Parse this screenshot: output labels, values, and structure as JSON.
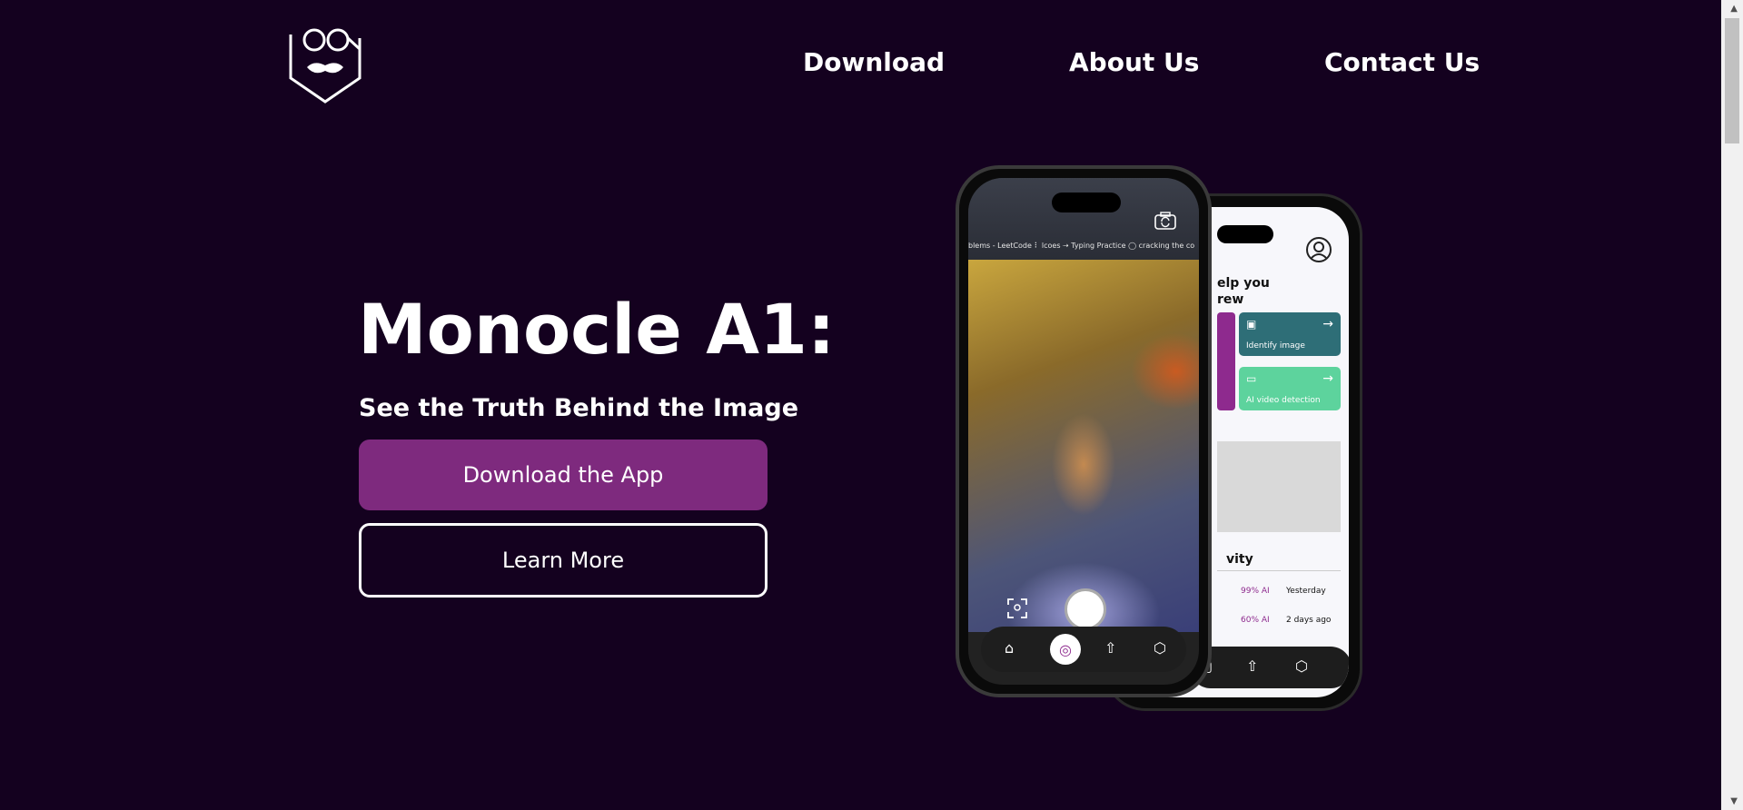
{
  "header": {
    "logo_alt": "Monocle logo",
    "nav": [
      {
        "label": "Download"
      },
      {
        "label": "About Us"
      },
      {
        "label": "Contact Us"
      }
    ]
  },
  "hero": {
    "title": "Monocle A1:",
    "subtitle": "See the Truth Behind the Image",
    "primary_button": "Download the App",
    "secondary_button": "Learn More"
  },
  "phone_back": {
    "heading": "elp you\nrew",
    "cards": [
      {
        "label": "Identify image",
        "icon": "image-icon"
      },
      {
        "label": "AI video detection",
        "icon": "video-icon"
      }
    ],
    "activity_title": "vity",
    "activity": [
      {
        "pct": "99% AI",
        "when": "Yesterday"
      },
      {
        "pct": "60% AI",
        "when": "2 days ago"
      }
    ]
  },
  "phone_front": {
    "bookmarks": "blems - LeetCode   ⠇ lcoes   ⇢ Typing Practice   ◯ cracking the co"
  },
  "colors": {
    "background": "#14011f",
    "primary_button": "#7e2a7e",
    "card_teal": "#2e6e77",
    "card_green": "#5dd39d",
    "accent_purple": "#8e2a8e"
  }
}
